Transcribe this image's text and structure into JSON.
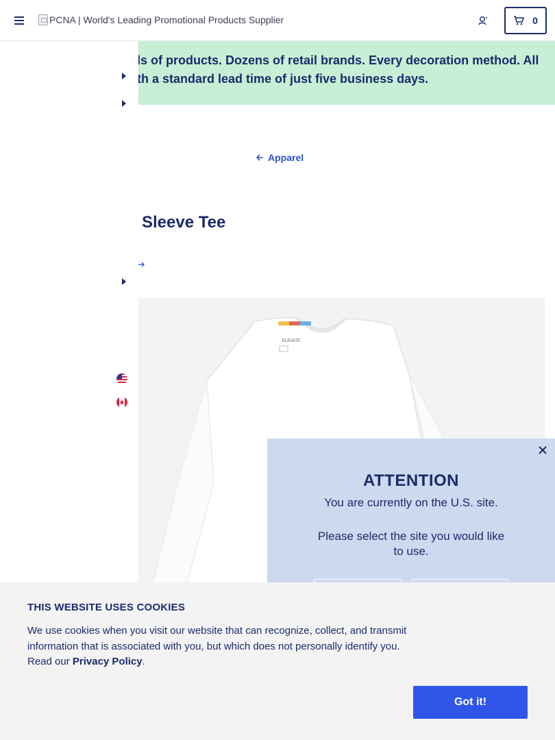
{
  "header": {
    "logo_alt": "PCNA | World's Leading Promotional Products Supplier",
    "cart_count": "0"
  },
  "banner": {
    "text": "ls of products. Dozens of retail brands. Every decoration method. All th a standard lead time of just five business days."
  },
  "product": {
    "back_label": "Apparel",
    "title": "Sleeve Tee",
    "tag_text": "ELEVATE"
  },
  "modal": {
    "title": "ATTENTION",
    "line1": "You are currently on the U.S. site.",
    "line2": "Please select the site you would like to use."
  },
  "cookie": {
    "title": "THIS WEBSITE USES COOKIES",
    "text_before": "We use cookies when you visit our website that can recognize, collect, and transmit information that is associated with you, but which does not personally identify you. Read our ",
    "link": "Privacy Policy",
    "text_after": ".",
    "button": "Got it!"
  },
  "colors": {
    "navy": "#1b2a6b",
    "banner_green": "#c7efd6",
    "modal_blue": "#cdd9ee",
    "cta_blue": "#2f55e8",
    "link_blue": "#2a56c6"
  },
  "icons": [
    "menu-icon",
    "user-icon",
    "cart-icon",
    "caret-right-icon",
    "arrow-left-icon",
    "arrow-right-icon",
    "us-flag-icon",
    "canada-flag-icon",
    "close-icon"
  ]
}
